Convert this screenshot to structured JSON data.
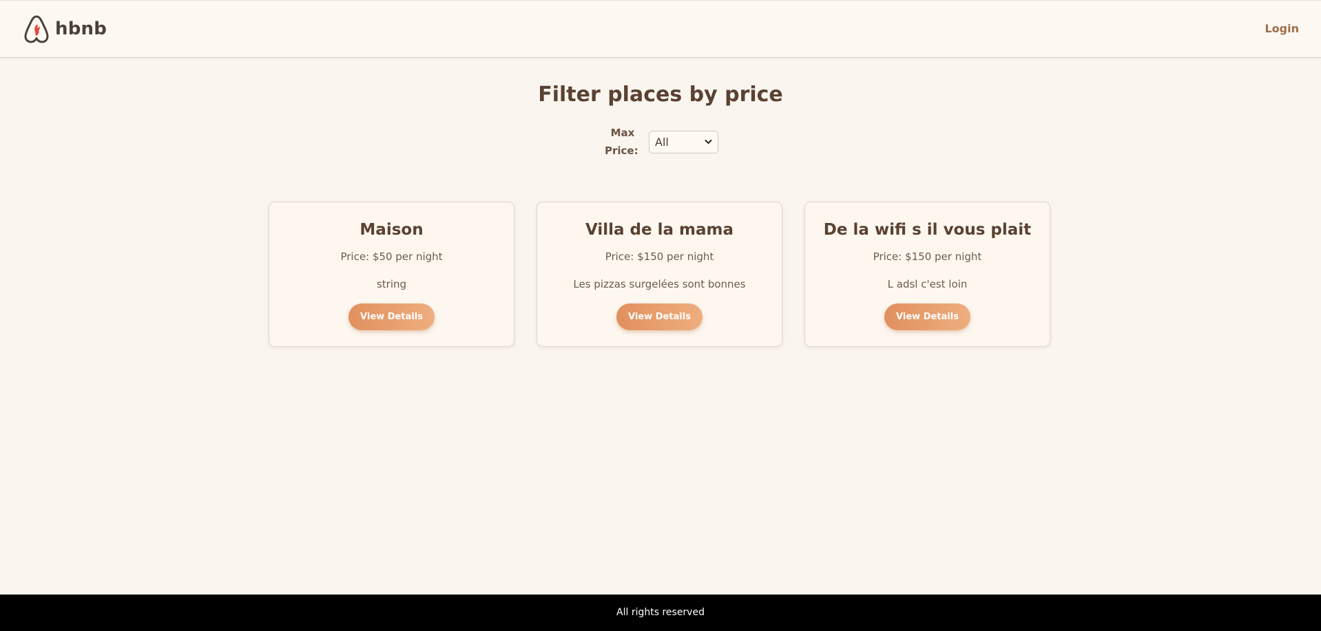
{
  "header": {
    "logo_text": "hbnb",
    "login_label": "Login"
  },
  "filter": {
    "title": "Filter places by price",
    "label_line1": "Max",
    "label_line2": "Price:",
    "selected_option": "All"
  },
  "places": [
    {
      "title": "Maison",
      "price": "Price: $50 per night",
      "description": "string",
      "button_label": "View Details"
    },
    {
      "title": "Villa de la mama",
      "price": "Price: $150 per night",
      "description": "Les pizzas surgelées sont bonnes",
      "button_label": "View Details"
    },
    {
      "title": "De la wifi s il vous plait",
      "price": "Price: $150 per night",
      "description": "L adsl c'est loin",
      "button_label": "View Details"
    }
  ],
  "footer": {
    "text": "All rights reserved"
  },
  "colors": {
    "accent_gradient_start": "#e1905e",
    "accent_gradient_end": "#eeae7f",
    "logo_flame": "#e2473b",
    "text_brown": "#5a4131"
  }
}
